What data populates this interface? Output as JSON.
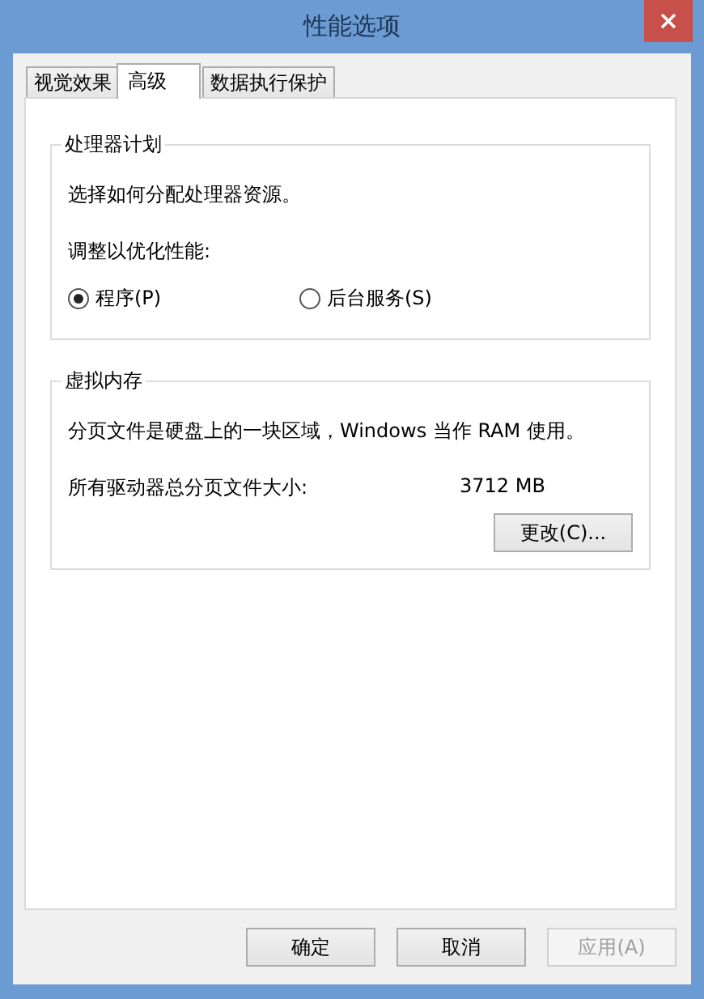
{
  "window": {
    "title": "性能选项"
  },
  "tabs": [
    {
      "label": "视觉效果",
      "selected": false
    },
    {
      "label": "高级",
      "selected": true
    },
    {
      "label": "数据执行保护",
      "selected": false
    }
  ],
  "processor_group": {
    "title": "处理器计划",
    "description": "选择如何分配处理器资源。",
    "prompt": "调整以优化性能:",
    "options": [
      {
        "label": "程序(P)",
        "selected": true
      },
      {
        "label": "后台服务(S)",
        "selected": false
      }
    ]
  },
  "virtual_memory_group": {
    "title": "虚拟内存",
    "description": "分页文件是硬盘上的一块区域，Windows 当作 RAM 使用。",
    "total_label": "所有驱动器总分页文件大小:",
    "total_value": "3712 MB",
    "button": "更改(C)..."
  },
  "buttons": [
    {
      "label": "确定",
      "disabled": false
    },
    {
      "label": "取消",
      "disabled": false
    },
    {
      "label": "应用(A)",
      "disabled": true
    }
  ]
}
